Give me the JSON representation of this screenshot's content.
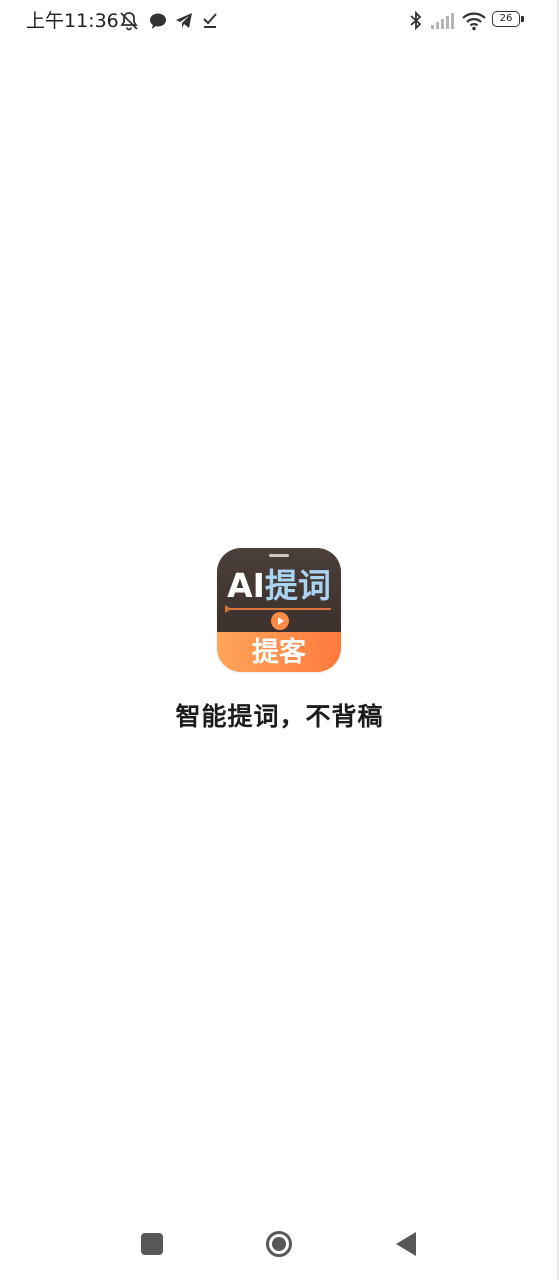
{
  "status_bar": {
    "time": "上午11:36",
    "battery_level": "26",
    "left_icons": [
      "bell-off-icon",
      "chat-bubble-icon",
      "telegram-icon",
      "download-done-icon"
    ],
    "right_icons": [
      "bluetooth-icon",
      "signal-icon",
      "wifi-icon",
      "battery-icon"
    ]
  },
  "splash": {
    "logo": {
      "main_text_latin": "AI",
      "main_text_cn": "提词",
      "sub_text": "提客"
    },
    "slogan": "智能提词，不背稿"
  },
  "nav_bar": {
    "buttons": [
      "recents",
      "home",
      "back"
    ]
  },
  "colors": {
    "logo_dark": "#3b302c",
    "logo_orange": "#ff7a3c",
    "logo_blue_text": "#a9d4f2",
    "nav_icon": "#585858"
  }
}
